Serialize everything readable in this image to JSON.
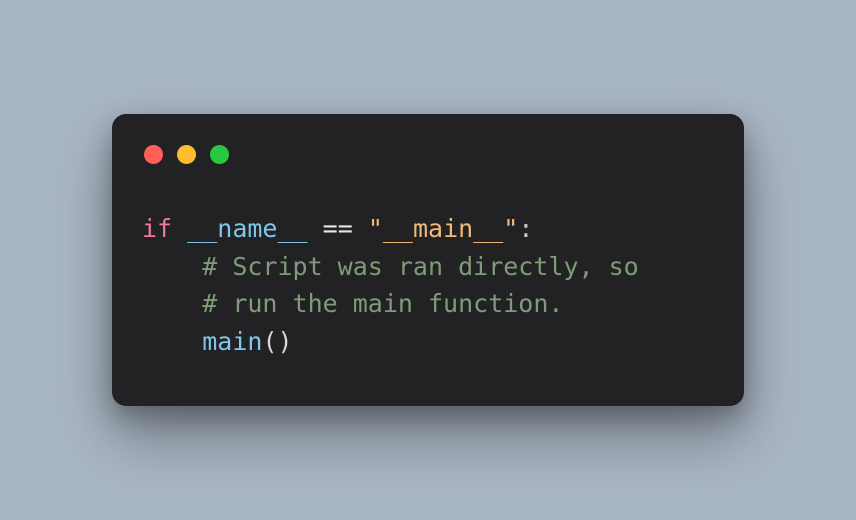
{
  "window": {
    "traffic_lights": {
      "close": "red",
      "minimize": "yellow",
      "zoom": "green"
    }
  },
  "code": {
    "indent": "    ",
    "line1": {
      "keyword": "if",
      "identifier": "__name__",
      "operator": "==",
      "string": "\"__main__\"",
      "colon": ":"
    },
    "line2": {
      "comment": "# Script was ran directly, so"
    },
    "line3": {
      "comment": "# run the main function."
    },
    "line4": {
      "fn": "main",
      "open": "(",
      "close": ")"
    }
  },
  "colors": {
    "bg_page": "#a9b6c4",
    "bg_window": "#222225",
    "keyword": "#f07993",
    "identifier": "#7ec7e6",
    "string": "#f0b97a",
    "comment": "#7e9c78"
  }
}
